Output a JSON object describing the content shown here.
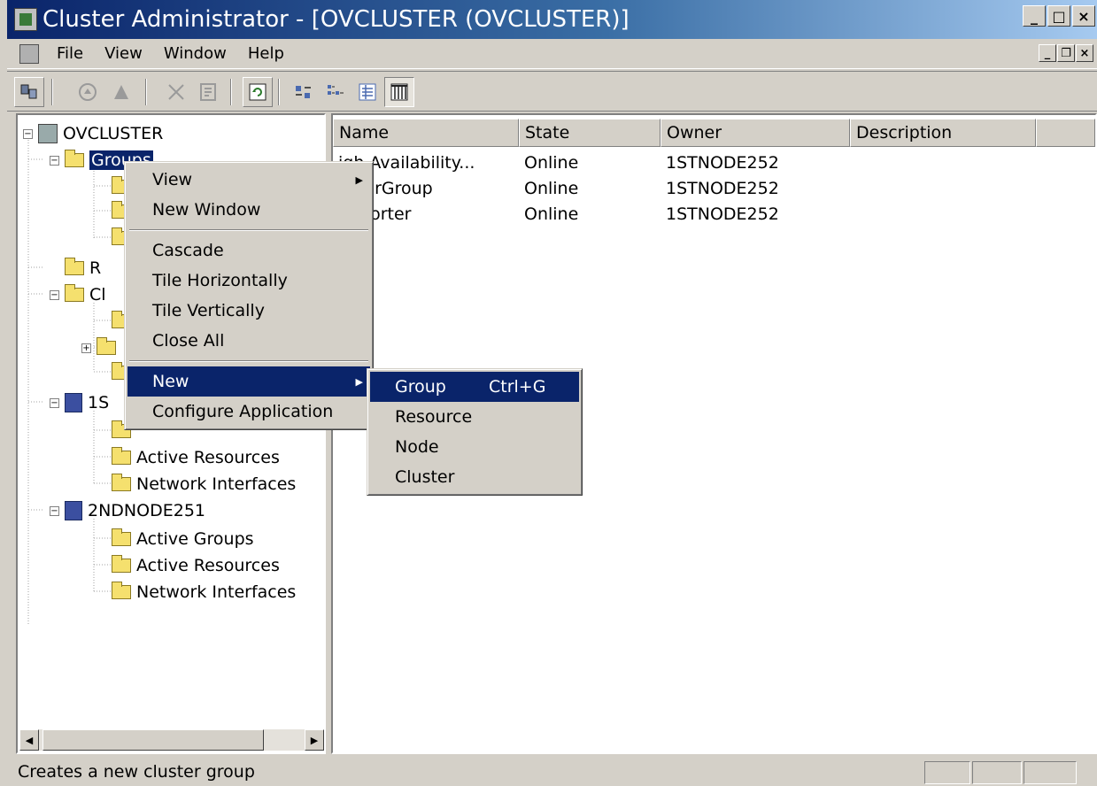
{
  "window": {
    "title": "Cluster Administrator - [OVCLUSTER (OVCLUSTER)]",
    "controls": {
      "minimize": "_",
      "maximize": "□",
      "close": "×"
    }
  },
  "menubar": {
    "items": [
      "File",
      "View",
      "Window",
      "Help"
    ],
    "mdi_controls": {
      "minimize": "_",
      "restore": "❐",
      "close": "×"
    }
  },
  "toolbar": {
    "buttons": [
      {
        "name": "open-connection",
        "icon": "cluster-icon"
      },
      {
        "name": "bring-online",
        "icon": "online-icon"
      },
      {
        "name": "take-offline",
        "icon": "offline-icon"
      },
      {
        "name": "delete",
        "icon": "delete-icon"
      },
      {
        "name": "properties",
        "icon": "properties-icon"
      },
      {
        "name": "refresh",
        "icon": "refresh-icon"
      },
      {
        "name": "large-icons",
        "icon": "large-icons-icon"
      },
      {
        "name": "small-icons",
        "icon": "small-icons-icon"
      },
      {
        "name": "list",
        "icon": "list-icon"
      },
      {
        "name": "details",
        "icon": "details-icon"
      }
    ]
  },
  "tree": {
    "root": "OVCLUSTER",
    "groups": "Groups",
    "resources_partial": "R",
    "cluster_config_partial": "Cl",
    "node1_partial": "1S",
    "node1_child_active_resources": "Active Resources",
    "node1_child_network_interfaces": "Network Interfaces",
    "node2": "2NDNODE251",
    "node2_children": [
      "Active Groups",
      "Active Resources",
      "Network Interfaces"
    ]
  },
  "list": {
    "columns": [
      "Name",
      "State",
      "Owner",
      "Description"
    ],
    "rows": [
      {
        "name": "igh Availability...",
        "state": "Online",
        "owner": "1STNODE252",
        "description": ""
      },
      {
        "name": "usterGroup",
        "state": "Online",
        "owner": "1STNODE252",
        "description": ""
      },
      {
        "name": "Reporter",
        "state": "Online",
        "owner": "1STNODE252",
        "description": ""
      }
    ]
  },
  "context_menu": {
    "view": "View",
    "new_window": "New Window",
    "cascade": "Cascade",
    "tile_horizontally": "Tile Horizontally",
    "tile_vertically": "Tile Vertically",
    "close_all": "Close All",
    "new": "New",
    "configure_application": "Configure Application"
  },
  "submenu": {
    "group": "Group",
    "group_shortcut": "Ctrl+G",
    "resource": "Resource",
    "node": "Node",
    "cluster": "Cluster"
  },
  "statusbar": {
    "text": "Creates a new cluster group"
  }
}
